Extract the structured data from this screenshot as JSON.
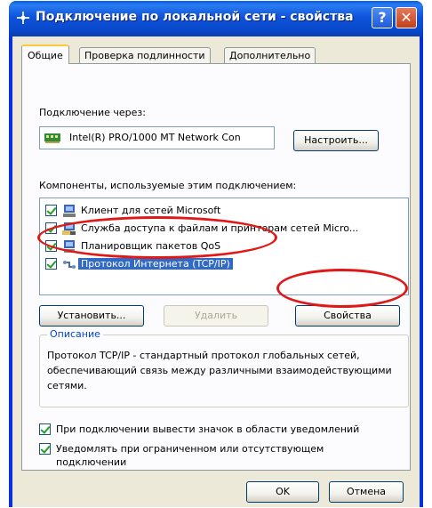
{
  "window": {
    "title": "Подключение по локальной сети - свойства",
    "help_label": "?",
    "close_label": "✕"
  },
  "tabs": [
    {
      "label": "Общие",
      "active": true
    },
    {
      "label": "Проверка подлинности",
      "active": false
    },
    {
      "label": "Дополнительно",
      "active": false
    }
  ],
  "connection": {
    "label": "Подключение через:",
    "adapter": "Intel(R) PRO/1000 MT Network Con",
    "configure_label": "Настроить..."
  },
  "components": {
    "label": "Компоненты, используемые этим подключением:",
    "items": [
      {
        "label": "Клиент для сетей Microsoft",
        "checked": true,
        "icon": "network-client-icon"
      },
      {
        "label": "Служба доступа к файлам и принтерам сетей Micro...",
        "checked": true,
        "icon": "file-printer-service-icon"
      },
      {
        "label": "Планировщик пакетов QoS",
        "checked": true,
        "icon": "qos-scheduler-icon"
      },
      {
        "label": "Протокол Интернета (TCP/IP)",
        "checked": true,
        "icon": "protocol-icon",
        "selected": true
      }
    ]
  },
  "buttons": {
    "install": "Установить...",
    "remove": "Удалить",
    "properties": "Свойства"
  },
  "description": {
    "title": "Описание",
    "text": "Протокол TCP/IP - стандартный протокол глобальных сетей, обеспечивающий связь между различными взаимодействующими сетями."
  },
  "options": {
    "show_icon": {
      "label": "При подключении вывести значок в области уведомлений",
      "checked": true
    },
    "notify": {
      "label": "Уведомлять при ограниченном или отсутствующем подключении",
      "checked": true
    }
  },
  "footer": {
    "ok": "OK",
    "cancel": "Отмена"
  },
  "colors": {
    "titlebar": "#0f53dc",
    "dialog_bg": "#ece9d8",
    "selection": "#316ac5",
    "annotation": "#e01818",
    "group_title": "#0046d5"
  }
}
